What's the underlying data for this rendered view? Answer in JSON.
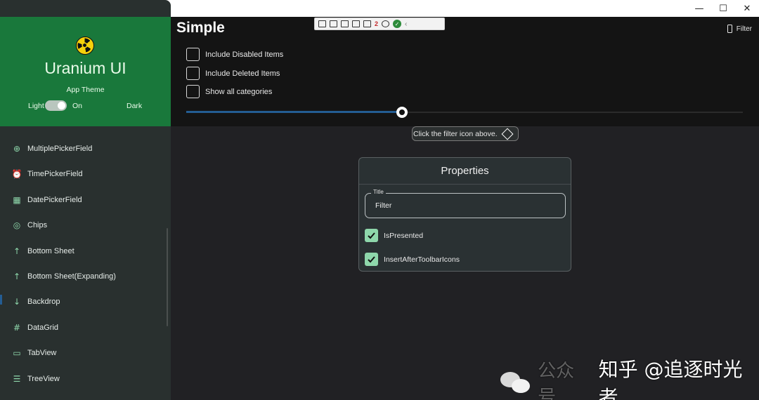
{
  "window": {
    "minimize": "—",
    "maximize": "☐",
    "close": "✕"
  },
  "sidebar": {
    "app_name": "Uranium UI",
    "theme_label": "App Theme",
    "theme_light": "Light",
    "theme_on": "On",
    "theme_dark": "Dark",
    "items": [
      {
        "label": "MultiplePickerField",
        "icon": "plus-circle-icon"
      },
      {
        "label": "TimePickerField",
        "icon": "alarm-clock-icon"
      },
      {
        "label": "DatePickerField",
        "icon": "calendar-icon"
      },
      {
        "label": "Chips",
        "icon": "target-icon"
      },
      {
        "label": "Bottom Sheet",
        "icon": "arrow-up-icon"
      },
      {
        "label": "Bottom Sheet(Expanding)",
        "icon": "arrow-up-icon"
      },
      {
        "label": "Backdrop",
        "icon": "arrow-down-icon"
      },
      {
        "label": "DataGrid",
        "icon": "hash-icon"
      },
      {
        "label": "TabView",
        "icon": "tab-icon"
      },
      {
        "label": "TreeView",
        "icon": "tree-list-icon"
      }
    ]
  },
  "page": {
    "title": "Simple",
    "filter_label": "Filter",
    "checkboxes": [
      {
        "label": "Include Disabled Items",
        "checked": false
      },
      {
        "label": "Include Deleted Items",
        "checked": false
      },
      {
        "label": "Show all categories",
        "checked": false
      }
    ],
    "slider_value": 0.388,
    "tooltip": "Click the filter icon above."
  },
  "properties": {
    "title": "Properties",
    "field_label": "Title",
    "field_value": "Filter",
    "options": [
      {
        "label": "IsPresented",
        "checked": true
      },
      {
        "label": "InsertAfterToolbarIcons",
        "checked": true
      }
    ]
  },
  "debug_toolbar": {
    "badge": "2"
  },
  "watermark": {
    "prefix": "公众号",
    "text": "知乎 @追逐时光者"
  },
  "colors": {
    "accent_green": "#19783b",
    "check_green": "#8ed7ab",
    "slider_blue": "#245d93"
  }
}
